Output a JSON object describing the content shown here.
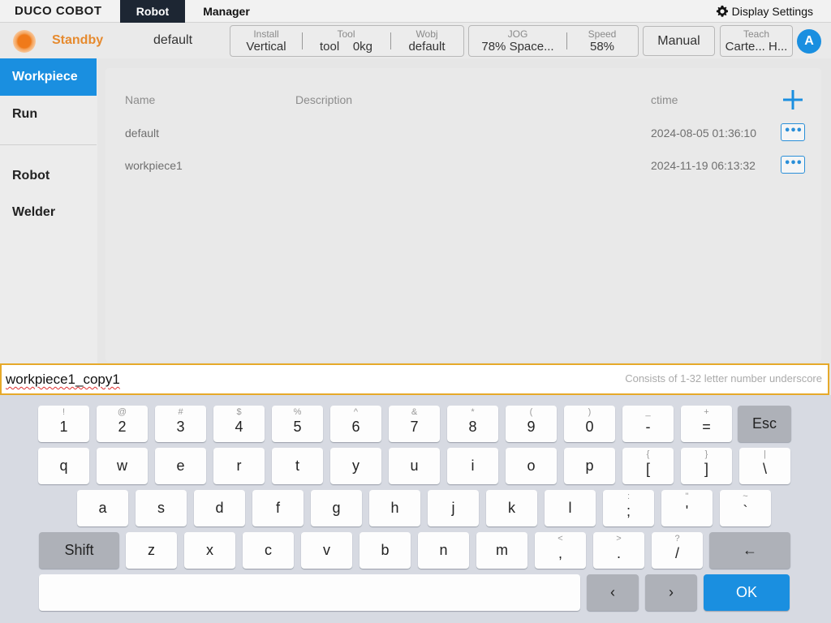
{
  "menubar": {
    "logo": "DUCO COBOT",
    "tabs": [
      "Robot",
      "Manager"
    ],
    "display_settings": "Display Settings"
  },
  "statusbar": {
    "state": "Standby",
    "program": "default",
    "install": {
      "label": "Install",
      "value": "Vertical"
    },
    "tool": {
      "label": "Tool",
      "name": "tool",
      "mass": "0kg"
    },
    "wobj": {
      "label": "Wobj",
      "value": "default"
    },
    "jog": {
      "label": "JOG",
      "value": "78%  Space..."
    },
    "speed": {
      "label": "Speed",
      "value": "58%"
    },
    "mode_button": "Manual",
    "teach": {
      "label": "Teach",
      "value": "Carte... H..."
    },
    "avatar": "A",
    "colors": {
      "status": "#e68a2e",
      "accent": "#1a8fe0"
    }
  },
  "leftnav": {
    "items": [
      "Workpiece",
      "Run",
      "Robot",
      "Welder"
    ]
  },
  "table": {
    "headers": {
      "name": "Name",
      "description": "Description",
      "ctime": "ctime"
    },
    "rows": [
      {
        "name": "default",
        "description": "",
        "ctime": "2024-08-05 01:36:10"
      },
      {
        "name": "workpiece1",
        "description": "",
        "ctime": "2024-11-19 06:13:32"
      }
    ]
  },
  "input": {
    "value": "workpiece1_copy1",
    "hint": "Consists of 1-32 letter number underscore"
  },
  "keyboard": {
    "row1": [
      {
        "main": "1",
        "sub": "!"
      },
      {
        "main": "2",
        "sub": "@"
      },
      {
        "main": "3",
        "sub": "#"
      },
      {
        "main": "4",
        "sub": "$"
      },
      {
        "main": "5",
        "sub": "%"
      },
      {
        "main": "6",
        "sub": "^"
      },
      {
        "main": "7",
        "sub": "&"
      },
      {
        "main": "8",
        "sub": "*"
      },
      {
        "main": "9",
        "sub": "("
      },
      {
        "main": "0",
        "sub": ")"
      },
      {
        "main": "-",
        "sub": "_"
      },
      {
        "main": "=",
        "sub": "+"
      }
    ],
    "row2": [
      {
        "main": "q"
      },
      {
        "main": "w"
      },
      {
        "main": "e"
      },
      {
        "main": "r"
      },
      {
        "main": "t"
      },
      {
        "main": "y"
      },
      {
        "main": "u"
      },
      {
        "main": "i"
      },
      {
        "main": "o"
      },
      {
        "main": "p"
      },
      {
        "main": "[",
        "sub": "{"
      },
      {
        "main": "]",
        "sub": "}"
      },
      {
        "main": "\\",
        "sub": "|"
      }
    ],
    "row3": [
      {
        "main": "a"
      },
      {
        "main": "s"
      },
      {
        "main": "d"
      },
      {
        "main": "f"
      },
      {
        "main": "g"
      },
      {
        "main": "h"
      },
      {
        "main": "j"
      },
      {
        "main": "k"
      },
      {
        "main": "l"
      },
      {
        "main": ";",
        "sub": ":"
      },
      {
        "main": "'",
        "sub": "\""
      },
      {
        "main": "`",
        "sub": "~"
      }
    ],
    "row4": [
      {
        "main": "z"
      },
      {
        "main": "x"
      },
      {
        "main": "c"
      },
      {
        "main": "v"
      },
      {
        "main": "b"
      },
      {
        "main": "n"
      },
      {
        "main": "m"
      },
      {
        "main": ",",
        "sub": "<"
      },
      {
        "main": ".",
        "sub": ">"
      },
      {
        "main": "/",
        "sub": "?"
      }
    ],
    "esc": "Esc",
    "shift": "Shift",
    "backspace": "←",
    "left": "‹",
    "right": "›",
    "ok": "OK"
  }
}
